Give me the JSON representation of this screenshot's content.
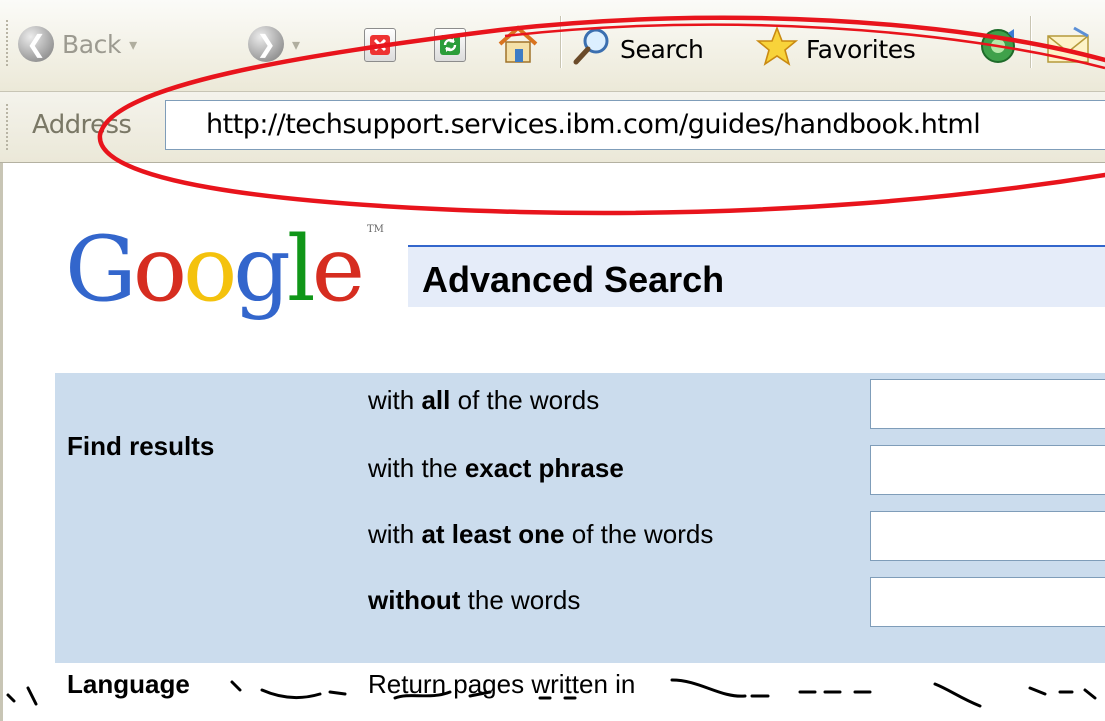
{
  "toolbar": {
    "back_label": "Back",
    "search_label": "Search",
    "favorites_label": "Favorites"
  },
  "address_bar": {
    "label": "Address",
    "url": "http://techsupport.services.ibm.com/guides/handbook.html"
  },
  "page": {
    "logo_text": "Google",
    "logo_tm": "TM",
    "heading": "Advanced Search",
    "find_results_label": "Find results",
    "rows": [
      {
        "pre": "with ",
        "bold": "all",
        "post": " of the words"
      },
      {
        "pre": "with the ",
        "bold": "exact phrase",
        "post": ""
      },
      {
        "pre": "with ",
        "bold": "at least one",
        "post": " of the words"
      },
      {
        "pre": "",
        "bold": "without",
        "post": " the words"
      }
    ],
    "language_label": "Language",
    "language_text": "Return pages written in"
  },
  "colors": {
    "panel": "#cbdced",
    "heading_bar": "#e5ecf9",
    "annotation_ellipse": "#e8141c"
  },
  "icons": [
    "back-icon",
    "forward-icon",
    "stop-icon",
    "refresh-icon",
    "home-icon",
    "search-icon",
    "favorites-icon",
    "media-icon",
    "mail-icon"
  ]
}
